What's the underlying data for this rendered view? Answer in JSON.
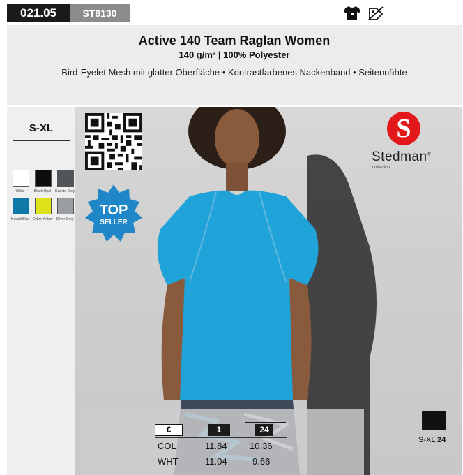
{
  "header": {
    "catalog_no": "021.05",
    "article_no": "ST8130",
    "title": "Active 140 Team Raglan Women",
    "subtitle": "140 g/m² | 100% Polyester",
    "description": "Bird-Eyelet Mesh mit glatter Oberfläche • Kontrastfarbenes Nackenband • Seitennähte",
    "icons": [
      "tshirt-icon",
      "no-iron-icon"
    ]
  },
  "sizes": {
    "range": "S-XL"
  },
  "colors": [
    {
      "name": "White",
      "hex": "#ffffff"
    },
    {
      "name": "Black Opal",
      "hex": "#0d0d0d"
    },
    {
      "name": "Granite Grey",
      "hex": "#4f5559"
    },
    {
      "name": "Hawaii Blue",
      "hex": "#0e78a6"
    },
    {
      "name": "Cyber Yellow",
      "hex": "#dde21b"
    },
    {
      "name": "Silver Grey",
      "hex": "#9a9da1"
    }
  ],
  "badge": {
    "line1": "TOP",
    "line2": "SELLER",
    "color": "#1f86c8"
  },
  "brand": {
    "name": "Stedman",
    "registered": "®",
    "collection": "collection",
    "logo_color": "#e2181b"
  },
  "pricing": {
    "currency": "€",
    "columns": [
      "1",
      "24"
    ],
    "rows": [
      {
        "label": "COL",
        "values": [
          "11.84",
          "10.36"
        ]
      },
      {
        "label": "WHT",
        "values": [
          "11.04",
          "9.66"
        ]
      }
    ]
  },
  "packaging": {
    "size": "S-XL",
    "qty": "24"
  },
  "product_color": "#1fa3d8"
}
